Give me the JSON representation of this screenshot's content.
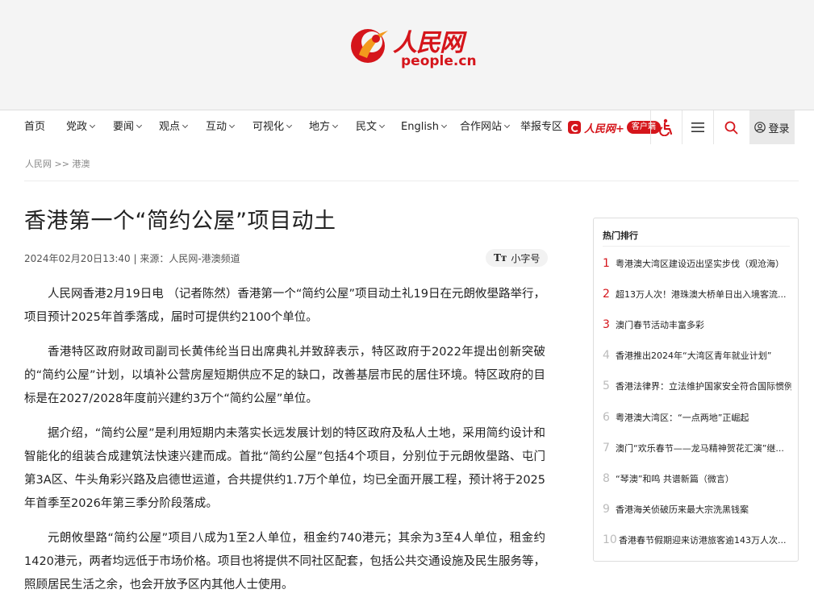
{
  "brand": {
    "name_cn": "人民网",
    "name_en": "people.cn",
    "brand_color": "#d5151b"
  },
  "nav": {
    "items": [
      {
        "label": "首页",
        "dropdown": false
      },
      {
        "label": "党政",
        "dropdown": true
      },
      {
        "label": "要闻",
        "dropdown": true
      },
      {
        "label": "观点",
        "dropdown": true
      },
      {
        "label": "互动",
        "dropdown": true
      },
      {
        "label": "可视化",
        "dropdown": true
      },
      {
        "label": "地方",
        "dropdown": true
      },
      {
        "label": "民文",
        "dropdown": true
      },
      {
        "label": "English",
        "dropdown": true
      },
      {
        "label": "合作网站",
        "dropdown": true
      },
      {
        "label": "举报专区",
        "dropdown": false
      }
    ],
    "app_name": "人民网+",
    "app_tag": "客户端",
    "accessibility_icon": "wheelchair-icon",
    "menu_icon": "hamburger-menu-icon",
    "search_icon": "search-icon",
    "login_label": "登录",
    "login_icon": "user-icon"
  },
  "breadcrumb": "人民网 >> 港澳",
  "article": {
    "title": "香港第一个“简约公屋”项目动土",
    "meta": "2024年02月20日13:40 | 来源：人民网-港澳频道",
    "font_size_toggle": "小字号",
    "font_size_icon_text": "Tт",
    "paragraphs": [
      "人民网香港2月19日电 （记者陈然）香港第一个“简约公屋”项目动土礼19日在元朗攸壆路举行，项目预计2025年首季落成，届时可提供约2100个单位。",
      "香港特区政府财政司副司长黄伟纶当日出席典礼并致辞表示，特区政府于2022年提出创新突破的“简约公屋”计划，以填补公营房屋短期供应不足的缺口，改善基层市民的居住环境。特区政府的目标是在2027/2028年度前兴建约3万个“简约公屋”单位。",
      "据介绍，“简约公屋”是利用短期内未落实长远发展计划的特区政府及私人土地，采用简约设计和智能化的组装合成建筑法快速兴建而成。首批“简约公屋”包括4个项目，分别位于元朗攸壆路、屯门第3A区、牛头角彩兴路及启德世运道，合共提供约1.7万个单位，均已全面开展工程，预计将于2025年首季至2026年第三季分阶段落成。",
      "元朗攸壆路“简约公屋”项目八成为1至2人单位，租金约740港元；其余为3至4人单位，租金约1420港元，两者均远低于市场价格。项目也将提供不同社区配套，包括公共交通设施及民生服务等，照顾居民生活之余，也会开放予区内其他人士使用。"
    ]
  },
  "sidebar": {
    "title": "热门排行",
    "items": [
      {
        "rank": "1",
        "text": "粤港澳大湾区建设迈出坚实步伐（观沧海）"
      },
      {
        "rank": "2",
        "text": "超13万人次！港珠澳大桥单日出入境客流..."
      },
      {
        "rank": "3",
        "text": "澳门春节活动丰富多彩"
      },
      {
        "rank": "4",
        "text": "香港推出2024年“大湾区青年就业计划”"
      },
      {
        "rank": "5",
        "text": "香港法律界：立法维护国家安全符合国际惯例"
      },
      {
        "rank": "6",
        "text": "粤港澳大湾区：“一点两地”正崛起"
      },
      {
        "rank": "7",
        "text": "澳门“欢乐春节——龙马精神贺花汇演”继..."
      },
      {
        "rank": "8",
        "text": "“琴澳”和鸣 共谱新篇（微言）"
      },
      {
        "rank": "9",
        "text": "香港海关侦破历来最大宗洗黑钱案"
      },
      {
        "rank": "10",
        "text": "香港春节假期迎来访港旅客逾143万人次..."
      }
    ]
  }
}
